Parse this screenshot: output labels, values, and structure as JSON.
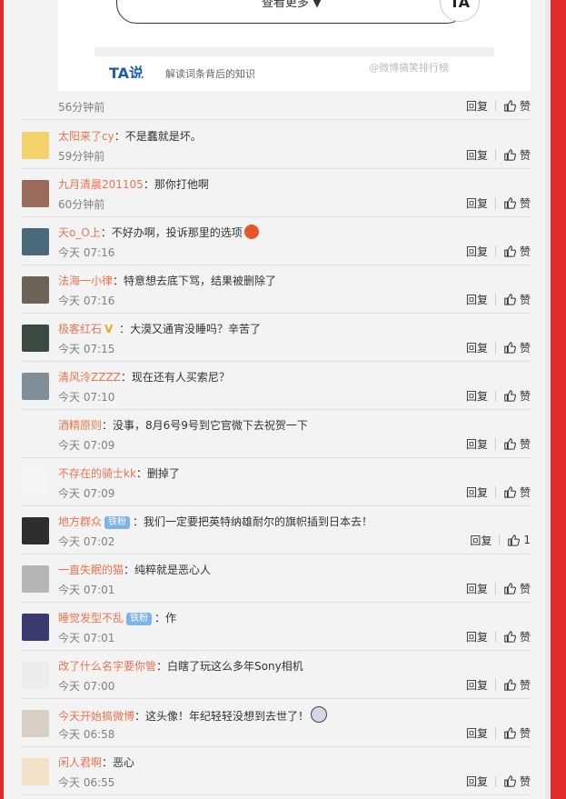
{
  "top_card": {
    "more_label": "查看更多 ▼",
    "ta_circle_text": "TA",
    "ta_logo": "TA说",
    "ta_sub": "解读词条背后的知识",
    "watermark": "@微博搞笑排行榜"
  },
  "first_time": "56分钟前",
  "action_labels": {
    "reply": "回复",
    "like": "赞"
  },
  "comments": [
    {
      "user": "太阳来了cy",
      "text": "：不是蠢就是坏。",
      "time": "59分钟前",
      "avatar_color": "#f5d36c"
    },
    {
      "user": "九月清晨201105",
      "text": "：那你打他啊",
      "time": "60分钟前",
      "avatar_color": "#9a6a5a"
    },
    {
      "user": "天o_O上",
      "text": "：不好办啊，投诉那里的选项",
      "time": "今天 07:16",
      "avatar_color": "#4a6a7a"
    },
    {
      "user": "法海一小律",
      "text": "：特意想去底下骂，结果被删除了",
      "time": "今天 07:16",
      "avatar_color": "#6b6355"
    },
    {
      "user": "极客红石",
      "text": "：大漠又通宵没睡吗？辛苦了",
      "time": "今天 07:15",
      "avatar_color": "#3b4a3e"
    },
    {
      "user": "清风泠ZZZZ",
      "text": "：现在还有人买索尼？",
      "time": "今天 07:10",
      "avatar_color": "#7f8e99"
    },
    {
      "user": "酒精原则",
      "text": "：没事，8月6号9号到它官微下去祝贺一下",
      "time": "今天 07:09",
      "avatar_color": "#f2f2f2"
    },
    {
      "user": "不存在的骑士kk",
      "text": "：删掉了",
      "time": "今天 07:09",
      "avatar_color": "#f5f5f5"
    },
    {
      "user": "地方群众",
      "badge": "铁粉",
      "text": "：我们一定要把英特纳雄耐尔的旗帜插到日本去！",
      "time": "今天 07:02",
      "like_count": "1",
      "avatar_color": "#2e2e2e"
    },
    {
      "user": "一直失眠的猫",
      "text": "：纯粹就是恶心人",
      "time": "今天 07:01",
      "avatar_color": "#b6b6b6"
    },
    {
      "user": "睡觉发型不乱",
      "badge": "铁粉",
      "text": "：作",
      "time": "今天 07:01",
      "avatar_color": "#3a3a6e"
    },
    {
      "user": "改了什么名字要你管",
      "text": "：白瞎了玩这么多年Sony相机",
      "time": "今天 07:00",
      "avatar_color": "#ededed"
    },
    {
      "user": "今天开始搞微博",
      "text": "：这头像！年纪轻轻没想到去世了！",
      "time": "今天 06:58",
      "avatar_color": "#d8cfc4"
    },
    {
      "user": "闲人君啊",
      "text": "：恶心",
      "time": "今天 06:55",
      "avatar_color": "#f3e1c8"
    }
  ]
}
